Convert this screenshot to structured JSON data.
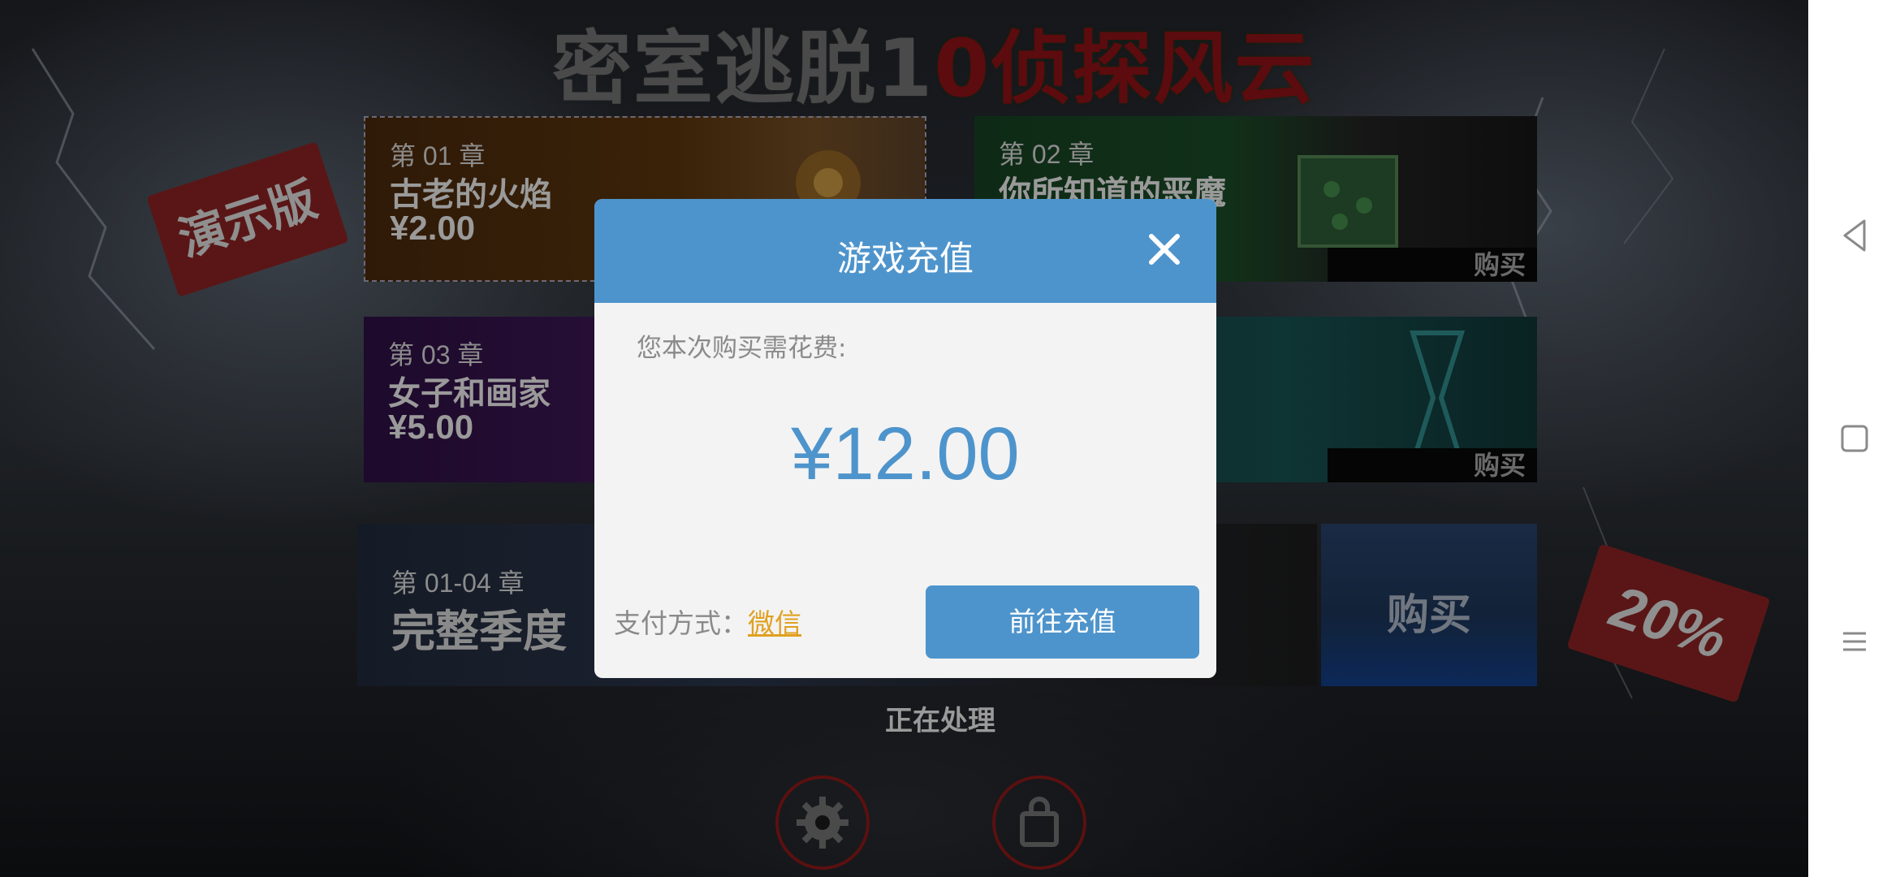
{
  "game": {
    "title_left": "密室逃脱1",
    "title_right": "0侦探风云",
    "demo_tag": "演示版",
    "discount_tag": "20%",
    "processing_text": "正在处理",
    "chapters": [
      {
        "num": "第 01 章",
        "name": "古老的火焰",
        "price": "¥2.00"
      },
      {
        "num": "第 02 章",
        "name": "你所知道的恶魔",
        "buy": "购买"
      },
      {
        "num": "第 03 章",
        "name": "女子和画家",
        "price": "¥5.00"
      },
      {
        "buy": "购买"
      }
    ],
    "season": {
      "num": "第 01-04 章",
      "name": "完整季度",
      "buy": "购买"
    },
    "icons": {
      "settings": "gear-icon",
      "shop": "bag-icon"
    },
    "colors": {
      "accent_red": "#5c0b0e",
      "dialog_blue": "#4e94cc",
      "link_gold": "#e0a020"
    }
  },
  "dialog": {
    "title": "游戏充值",
    "cost_label": "您本次购买需花费:",
    "amount": "¥12.00",
    "pay_label": "支付方式：",
    "pay_method": "微信",
    "recharge_button": "前往充值"
  },
  "navbar": {
    "back": "back-icon",
    "home": "home-icon",
    "menu": "menu-icon"
  }
}
